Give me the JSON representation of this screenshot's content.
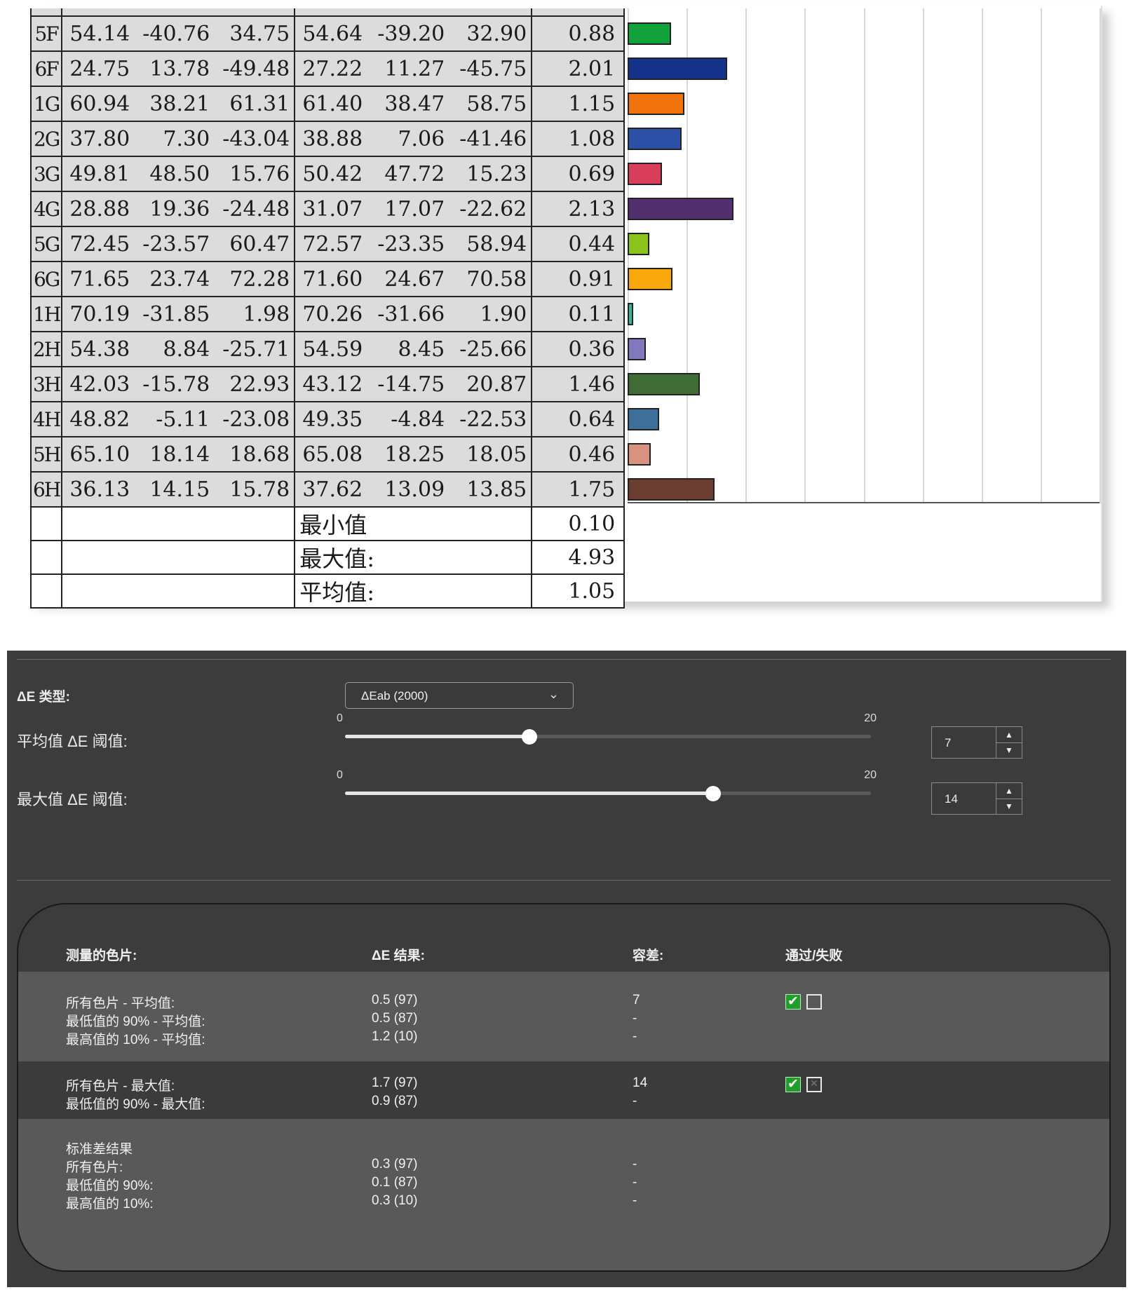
{
  "report": {
    "rows": [
      {
        "id": "5F",
        "ref": [
          "54.14",
          "-40.76",
          "34.75"
        ],
        "meas": [
          "54.64",
          "-39.20",
          "32.90"
        ],
        "de": "0.88",
        "color": "#11a23c"
      },
      {
        "id": "6F",
        "ref": [
          "24.75",
          "13.78",
          "-49.48"
        ],
        "meas": [
          "27.22",
          "11.27",
          "-45.75"
        ],
        "de": "2.01",
        "color": "#16338c"
      },
      {
        "id": "1G",
        "ref": [
          "60.94",
          "38.21",
          "61.31"
        ],
        "meas": [
          "61.40",
          "38.47",
          "58.75"
        ],
        "de": "1.15",
        "color": "#f0730d"
      },
      {
        "id": "2G",
        "ref": [
          "37.80",
          "7.30",
          "-43.04"
        ],
        "meas": [
          "38.88",
          "7.06",
          "-41.46"
        ],
        "de": "1.08",
        "color": "#2c50a6"
      },
      {
        "id": "3G",
        "ref": [
          "49.81",
          "48.50",
          "15.76"
        ],
        "meas": [
          "50.42",
          "47.72",
          "15.23"
        ],
        "de": "0.69",
        "color": "#d83d5c"
      },
      {
        "id": "4G",
        "ref": [
          "28.88",
          "19.36",
          "-24.48"
        ],
        "meas": [
          "31.07",
          "17.07",
          "-22.62"
        ],
        "de": "2.13",
        "color": "#522f6d"
      },
      {
        "id": "5G",
        "ref": [
          "72.45",
          "-23.57",
          "60.47"
        ],
        "meas": [
          "72.57",
          "-23.35",
          "58.94"
        ],
        "de": "0.44",
        "color": "#8cc21c"
      },
      {
        "id": "6G",
        "ref": [
          "71.65",
          "23.74",
          "72.28"
        ],
        "meas": [
          "71.60",
          "24.67",
          "70.58"
        ],
        "de": "0.91",
        "color": "#f8a70c"
      },
      {
        "id": "1H",
        "ref": [
          "70.19",
          "-31.85",
          "1.98"
        ],
        "meas": [
          "70.26",
          "-31.66",
          "1.90"
        ],
        "de": "0.11",
        "color": "#38b2a0"
      },
      {
        "id": "2H",
        "ref": [
          "54.38",
          "8.84",
          "-25.71"
        ],
        "meas": [
          "54.59",
          "8.45",
          "-25.66"
        ],
        "de": "0.36",
        "color": "#8278bd"
      },
      {
        "id": "3H",
        "ref": [
          "42.03",
          "-15.78",
          "22.93"
        ],
        "meas": [
          "43.12",
          "-14.75",
          "20.87"
        ],
        "de": "1.46",
        "color": "#3f6b35"
      },
      {
        "id": "4H",
        "ref": [
          "48.82",
          "-5.11",
          "-23.08"
        ],
        "meas": [
          "49.35",
          "-4.84",
          "-22.53"
        ],
        "de": "0.64",
        "color": "#3d6f99"
      },
      {
        "id": "5H",
        "ref": [
          "65.10",
          "18.14",
          "18.68"
        ],
        "meas": [
          "65.08",
          "18.25",
          "18.05"
        ],
        "de": "0.46",
        "color": "#d79380"
      },
      {
        "id": "6H",
        "ref": [
          "36.13",
          "14.15",
          "15.78"
        ],
        "meas": [
          "37.62",
          "13.09",
          "13.85"
        ],
        "de": "1.75",
        "color": "#6b3c30"
      }
    ],
    "summary": [
      {
        "label": "最小值",
        "value": "0.10"
      },
      {
        "label": "最大值:",
        "value": "4.93"
      },
      {
        "label": "平均值:",
        "value": "1.05"
      }
    ],
    "chart_scale_max": 9.5
  },
  "panel": {
    "de_type_label": "ΔE 类型:",
    "de_type_value": "ΔEab (2000)",
    "avg_label": "平均值 ΔE 阈值:",
    "max_label": "最大值 ΔE 阈值:",
    "avg_slider": {
      "min": "0",
      "max": "20",
      "value": 7
    },
    "max_slider": {
      "min": "0",
      "max": "20",
      "value": 14
    },
    "avg_spin": "7",
    "max_spin": "14",
    "headers": {
      "patch": "测量的色片:",
      "result": "ΔE 结果:",
      "tol": "容差:",
      "pass": "通过/失败"
    },
    "group1": {
      "labels": [
        "所有色片 - 平均值:",
        "最低值的 90% - 平均值:",
        "最高值的 10% - 平均值:"
      ],
      "results": [
        "0.5 (97)",
        "0.5 (87)",
        "1.2 (10)"
      ],
      "tols": [
        "7",
        "-",
        "-"
      ],
      "pass": true
    },
    "group2": {
      "labels": [
        "所有色片 - 最大值:",
        "最低值的 90% - 最大值:"
      ],
      "results": [
        "1.7 (97)",
        "0.9 (87)"
      ],
      "tols": [
        "14",
        "-"
      ],
      "pass": true
    },
    "group3": {
      "title": "标准差结果",
      "labels": [
        "所有色片:",
        "最低值的 90%:",
        "最高值的 10%:"
      ],
      "results": [
        "0.3 (97)",
        "0.1 (87)",
        "0.3 (10)"
      ],
      "tols": [
        "-",
        "-",
        "-"
      ]
    }
  }
}
